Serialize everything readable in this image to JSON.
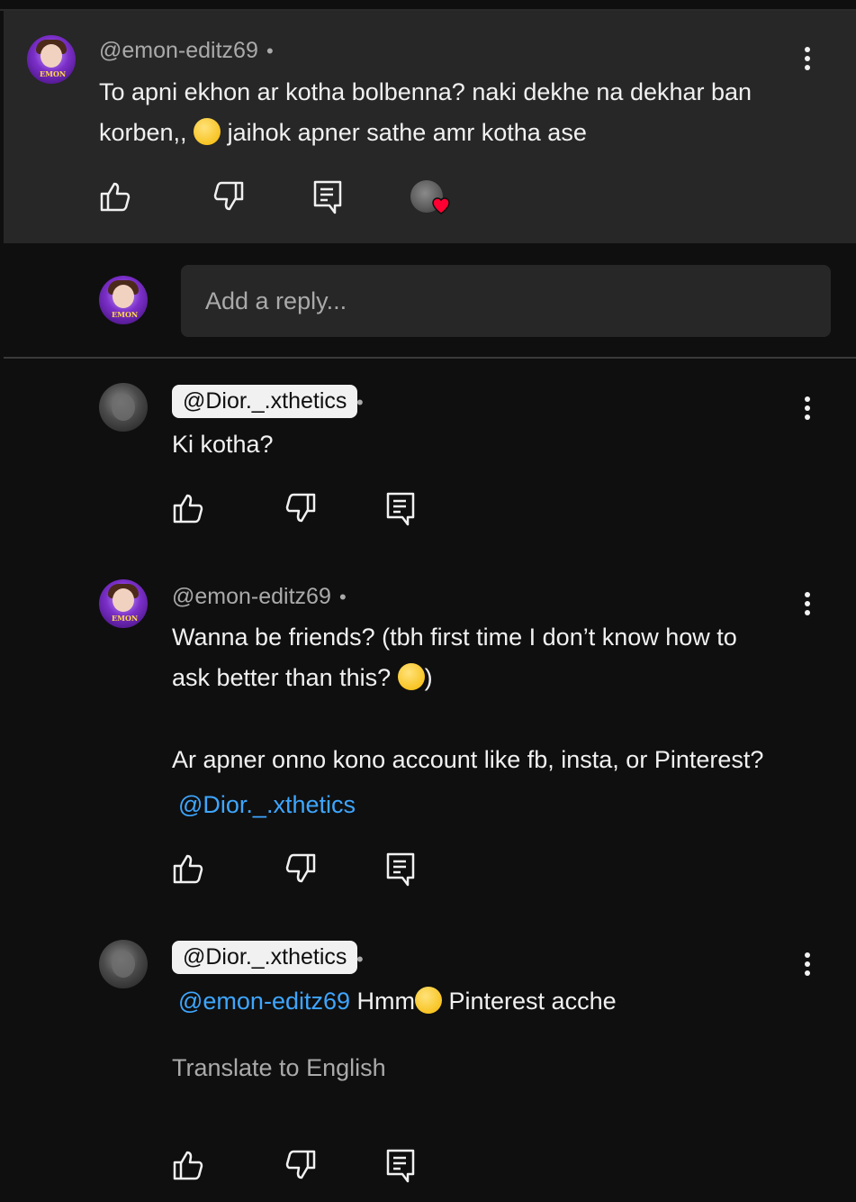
{
  "thread": {
    "main": {
      "author": "@emon-editz69",
      "separator": "•",
      "text_line1": "To apni ekhon ar kotha bolbenna?  naki dekhe na dekhar ban",
      "text_line2a": "korben,,",
      "text_line2b": " jaihok apner sathe amr kotha ase",
      "avatar_tag": "EMON"
    },
    "reply_input": {
      "placeholder": "Add a reply..."
    },
    "replies": [
      {
        "author": "@Dior._.xthetics",
        "separator": "•",
        "text": "Ki kotha?"
      },
      {
        "author": "@emon-editz69",
        "separator": "•",
        "text_line1": "Wanna be friends? (tbh first time I don’t know how to",
        "text_line2a": "ask better than this? ",
        "text_line2b": ")",
        "text_line3": "Ar apner onno kono account like fb, insta, or Pinterest?",
        "mention": "@Dior._.xthetics",
        "avatar_tag": "EMON"
      },
      {
        "author": "@Dior._.xthetics",
        "separator": "•",
        "mention": "@emon-editz69",
        "text_a": " Hmm",
        "text_b": " Pinterest acche",
        "translate": "Translate to English"
      }
    ]
  },
  "icons": [
    "thumbs-up-icon",
    "thumbs-down-icon",
    "reply-icon",
    "more-vert-icon",
    "heart-icon"
  ],
  "colors": {
    "background": "#0f0f0f",
    "card": "#272727",
    "mention": "#3ea6ff",
    "heart": "#ff0033"
  }
}
